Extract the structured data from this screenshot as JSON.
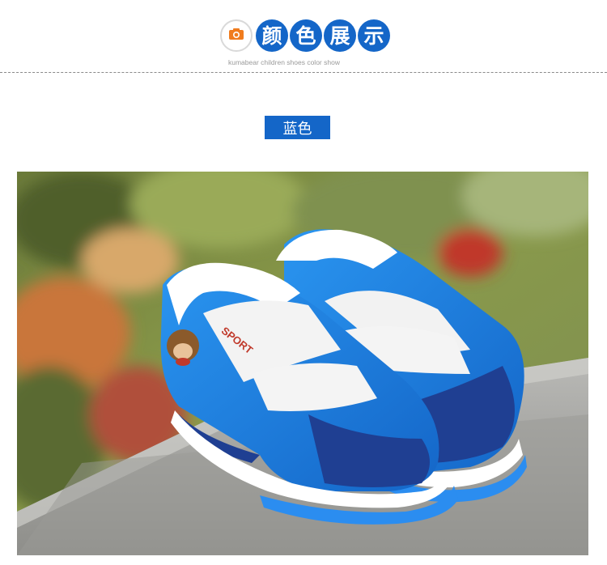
{
  "header": {
    "title_chars": [
      "颜",
      "色",
      "展",
      "示"
    ],
    "subtitle": "kumabear children shoes color show",
    "icon": "camera-icon"
  },
  "color_label": "蓝色",
  "product_photo": {
    "subject": "pair of blue children's sneakers on a stone curb",
    "strap_text": "SPORT",
    "colors": {
      "accent": "#1466c8",
      "shoe_blue": "#1a7be0",
      "suede_navy": "#1f3f92"
    }
  }
}
